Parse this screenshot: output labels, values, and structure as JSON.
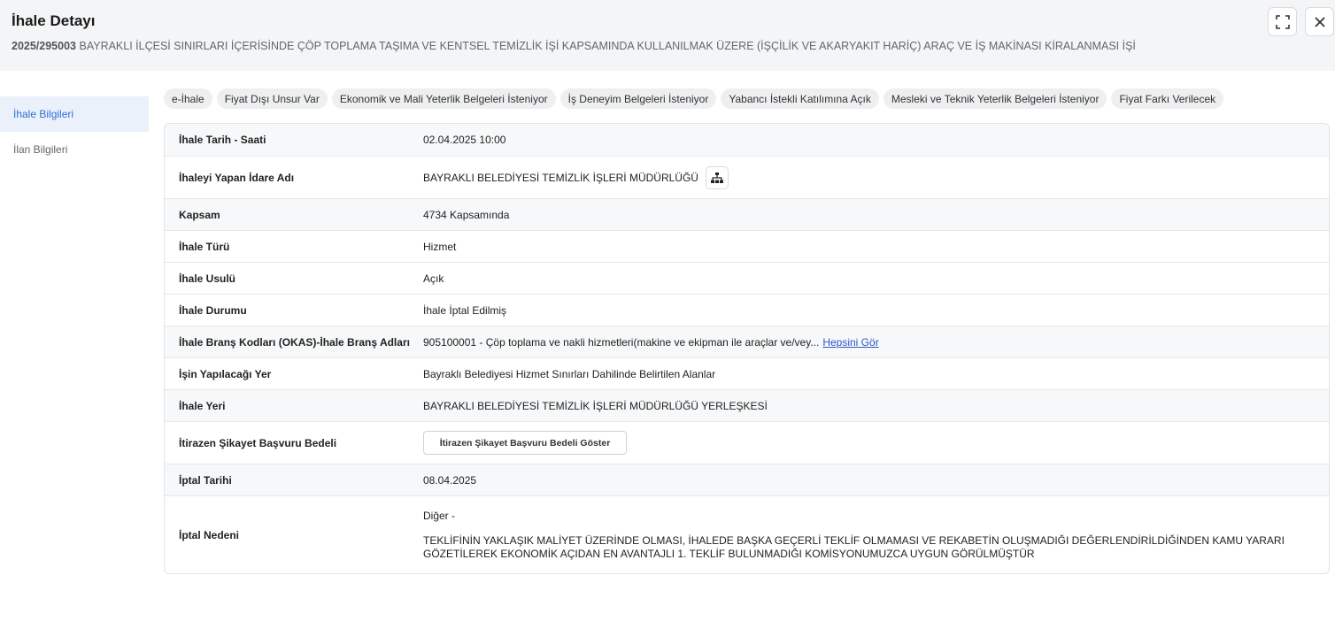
{
  "header": {
    "title": "İhale Detayı",
    "ikn": "2025/295003",
    "subject": "BAYRAKLI İLÇESİ SINIRLARI İÇERİSİNDE ÇÖP TOPLAMA TAŞIMA VE KENTSEL TEMİZLİK İŞİ KAPSAMINDA KULLANILMAK ÜZERE (İŞÇİLİK VE AKARYAKIT HARİÇ) ARAÇ VE İŞ MAKİNASI KİRALANMASI İŞİ",
    "expand_icon": "expand-icon",
    "close_icon": "close-icon"
  },
  "sidebar": {
    "items": [
      {
        "label": "İhale Bilgileri",
        "active": true
      },
      {
        "label": "İlan Bilgileri",
        "active": false
      }
    ]
  },
  "chips": [
    "e-İhale",
    "Fiyat Dışı Unsur Var",
    "Ekonomik ve Mali Yeterlik Belgeleri İsteniyor",
    "İş Deneyim Belgeleri İsteniyor",
    "Yabancı İstekli Katılımına Açık",
    "Mesleki ve Teknik Yeterlik Belgeleri İsteniyor",
    "Fiyat Farkı Verilecek"
  ],
  "details": {
    "tarih_label": "İhale Tarih - Saati",
    "tarih_value": "02.04.2025 10:00",
    "idare_label": "İhaleyi Yapan İdare Adı",
    "idare_value": "BAYRAKLI BELEDİYESİ TEMİZLİK İŞLERİ MÜDÜRLÜĞÜ",
    "kapsam_label": "Kapsam",
    "kapsam_value": "4734 Kapsamında",
    "tur_label": "İhale Türü",
    "tur_value": "Hizmet",
    "usul_label": "İhale Usulü",
    "usul_value": "Açık",
    "durum_label": "İhale Durumu",
    "durum_value": "İhale İptal Edilmiş",
    "brans_label": "İhale Branş Kodları (OKAS)-İhale Branş Adları",
    "brans_value": "905100001 - Çöp toplama ve nakli hizmetleri(makine ve ekipman ile araçlar ve/vey...",
    "brans_link": "Hepsini Gör",
    "yer_label": "İşin Yapılacağı Yer",
    "yer_value": "Bayraklı Belediyesi Hizmet Sınırları Dahilinde Belirtilen Alanlar",
    "ihale_yeri_label": "İhale Yeri",
    "ihale_yeri_value": "BAYRAKLI BELEDİYESİ TEMİZLİK İŞLERİ MÜDÜRLÜĞÜ YERLEŞKESİ",
    "itiraz_label": "İtirazen Şikayet Başvuru Bedeli",
    "itiraz_button": "İtirazen Şikayet Başvuru Bedeli Göster",
    "iptal_tarihi_label": "İptal Tarihi",
    "iptal_tarihi_value": "08.04.2025",
    "iptal_nedeni_label": "İptal Nedeni",
    "iptal_nedeni_line1": "Diğer -",
    "iptal_nedeni_line2": "TEKLİFİNİN YAKLAŞIK MALİYET ÜZERİNDE OLMASI, İHALEDE BAŞKA GEÇERLİ TEKLİF OLMAMASI VE REKABETİN OLUŞMADIĞI DEĞERLENDİRİLDİĞİNDEN KAMU YARARI GÖZETİLEREK EKONOMİK AÇIDAN EN AVANTAJLI 1. TEKLİF BULUNMADIĞI KOMİSYONUMUZCA UYGUN GÖRÜLMÜŞTÜR"
  }
}
